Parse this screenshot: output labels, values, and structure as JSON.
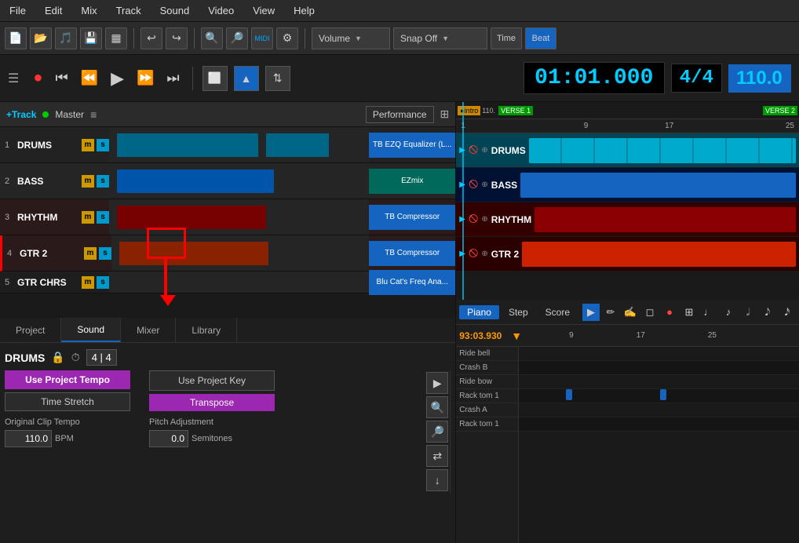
{
  "menu": {
    "items": [
      "File",
      "Edit",
      "Mix",
      "Track",
      "Sound",
      "Video",
      "View",
      "Help"
    ]
  },
  "toolbar": {
    "volume_label": "Volume",
    "snap_label": "Snap Off",
    "time_label": "Time",
    "beat_label": "Beat"
  },
  "transport": {
    "time_display": "01:01.000",
    "time_sig": "4/4",
    "bpm": "110.0"
  },
  "track_header": {
    "add_track": "+Track",
    "master": "Master",
    "performance": "Performance"
  },
  "tracks": [
    {
      "num": "1",
      "name": "DRUMS",
      "plugin": "TB EZQ Equalizer (L...",
      "plugin_color": "blue"
    },
    {
      "num": "2",
      "name": "BASS",
      "plugin": "EZmix",
      "plugin_color": "teal"
    },
    {
      "num": "3",
      "name": "RHYTHM",
      "plugin": "TB Compressor",
      "plugin_color": "blue"
    },
    {
      "num": "4",
      "name": "GTR 2",
      "plugin": "TB Compressor",
      "plugin_color": "blue"
    },
    {
      "num": "5",
      "name": "GTR CHRS",
      "plugin": "Blu Cat's Freq Ana...",
      "plugin_color": "blue"
    }
  ],
  "tabs": {
    "project": "Project",
    "sound": "Sound",
    "mixer": "Mixer",
    "library": "Library"
  },
  "sound_panel": {
    "track_name": "DRUMS",
    "time_sig": "4 | 4",
    "use_project_tempo": "Use Project Tempo",
    "time_stretch": "Time Stretch",
    "original_clip_tempo": "Original Clip Tempo",
    "tempo_value": "110.0",
    "bpm_label": "BPM",
    "use_project_key": "Use Project Key",
    "transpose": "Transpose",
    "pitch_adjustment": "Pitch Adjustment",
    "pitch_value": "0.0",
    "semitones_label": "Semitones"
  },
  "piano_roll": {
    "tabs": [
      "Piano",
      "Step",
      "Score"
    ],
    "time_display": "93:03.930",
    "markers": [
      "9",
      "17",
      "25"
    ],
    "keys": [
      "Ride bell",
      "Crash B",
      "Ride bow",
      "Rack tom 1",
      "Crash A",
      "Rack tom 1"
    ]
  },
  "arrangement": {
    "sections": [
      {
        "label": "intro",
        "color": "#cc9900"
      },
      {
        "label": "VERSE 1",
        "color": "#009900"
      },
      {
        "label": "VERSE 2",
        "color": "#009900"
      }
    ],
    "markers": [
      "1",
      "9",
      "17",
      "25"
    ],
    "tempo_marker": "110."
  }
}
